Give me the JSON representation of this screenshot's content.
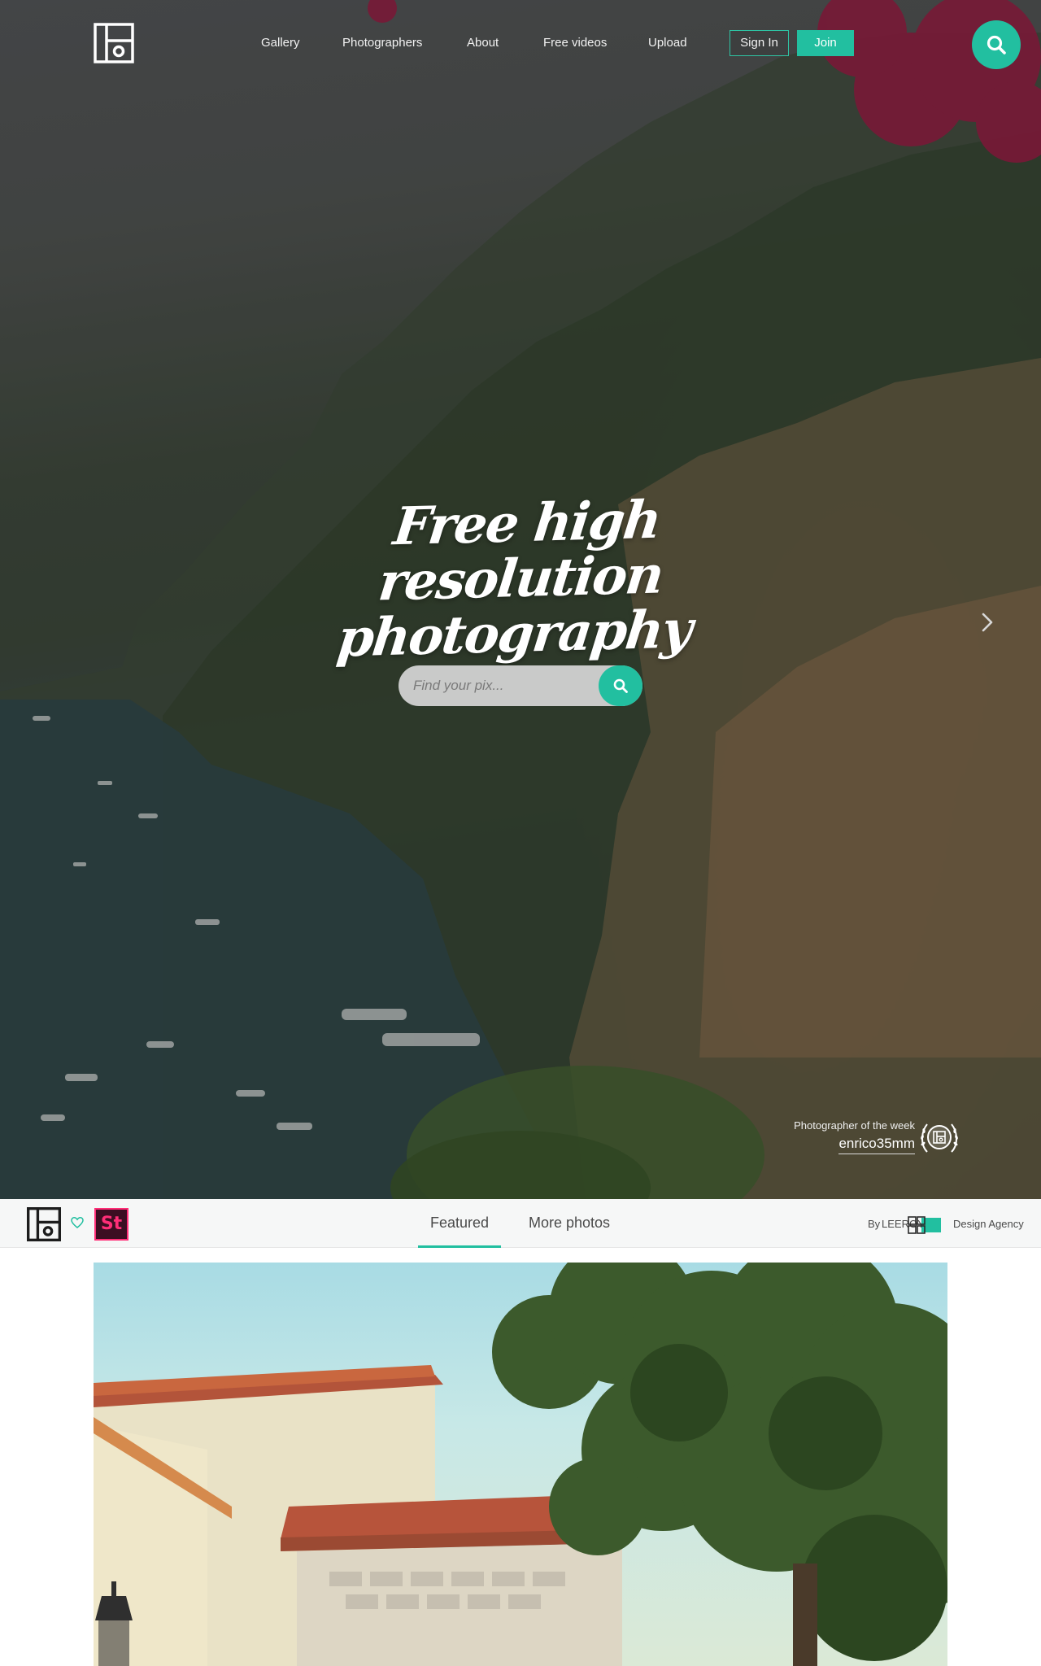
{
  "nav": {
    "links": [
      "Gallery",
      "Photographers",
      "About",
      "Free videos",
      "Upload"
    ],
    "sign_in": "Sign In",
    "join": "Join"
  },
  "hero": {
    "headline_line1": "Free high resolution",
    "headline_line2": "photography",
    "search_placeholder": "Find your pix...",
    "photographer_of_week_label": "Photographer of the week",
    "photographer_of_week_name": "enrico35mm"
  },
  "tabbar": {
    "stock_badge": "St",
    "tabs": [
      "Featured",
      "More photos"
    ],
    "active_tab": "Featured",
    "credit_by": "By",
    "credit_leeroy": "LEEROY",
    "credit_agency": "Design Agency"
  },
  "colors": {
    "accent": "#22bfa0",
    "stock_pink": "#ff2e77",
    "stock_bg": "#3c0e22"
  },
  "icons": {
    "logo": "pixabay-frame-logo-icon",
    "search": "search-icon",
    "next": "chevron-right-icon",
    "heart": "heart-outline-icon",
    "badge": "laurel-badge-icon"
  }
}
